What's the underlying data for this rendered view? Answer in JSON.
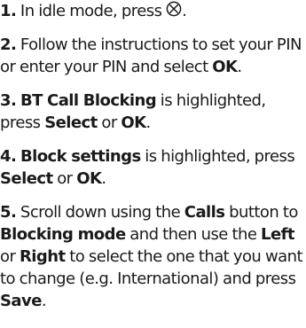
{
  "steps": [
    {
      "num": "1.",
      "parts": [
        {
          "t": " In idle mode, press "
        },
        {
          "icon": "block-key-icon",
          "caption": "Block"
        },
        {
          "t": "."
        }
      ]
    },
    {
      "num": "2.",
      "parts": [
        {
          "t": " Follow the instructions to set your PIN or enter your PIN and select "
        },
        {
          "t": "OK",
          "b": true
        },
        {
          "t": "."
        }
      ]
    },
    {
      "num": "3.",
      "parts": [
        {
          "t": " "
        },
        {
          "t": "BT Call Blocking",
          "b": true
        },
        {
          "t": " is highlighted, press "
        },
        {
          "t": "Select",
          "b": true
        },
        {
          "t": " or "
        },
        {
          "t": "OK",
          "b": true
        },
        {
          "t": "."
        }
      ]
    },
    {
      "num": "4.",
      "parts": [
        {
          "t": " "
        },
        {
          "t": "Block settings",
          "b": true
        },
        {
          "t": " is highlighted, press "
        },
        {
          "t": "Select",
          "b": true
        },
        {
          "t": " or "
        },
        {
          "t": "OK",
          "b": true
        },
        {
          "t": "."
        }
      ]
    },
    {
      "num": "5.",
      "parts": [
        {
          "t": " Scroll down using the "
        },
        {
          "t": "Calls",
          "b": true
        },
        {
          "t": " button to "
        },
        {
          "t": "Blocking mode",
          "b": true
        },
        {
          "t": " and then use the "
        },
        {
          "t": "Left",
          "b": true
        },
        {
          "t": " or "
        },
        {
          "t": "Right",
          "b": true
        },
        {
          "t": " to select the one that you want to change (e.g. International) and press "
        },
        {
          "t": "Save",
          "b": true
        },
        {
          "t": "."
        }
      ]
    }
  ]
}
